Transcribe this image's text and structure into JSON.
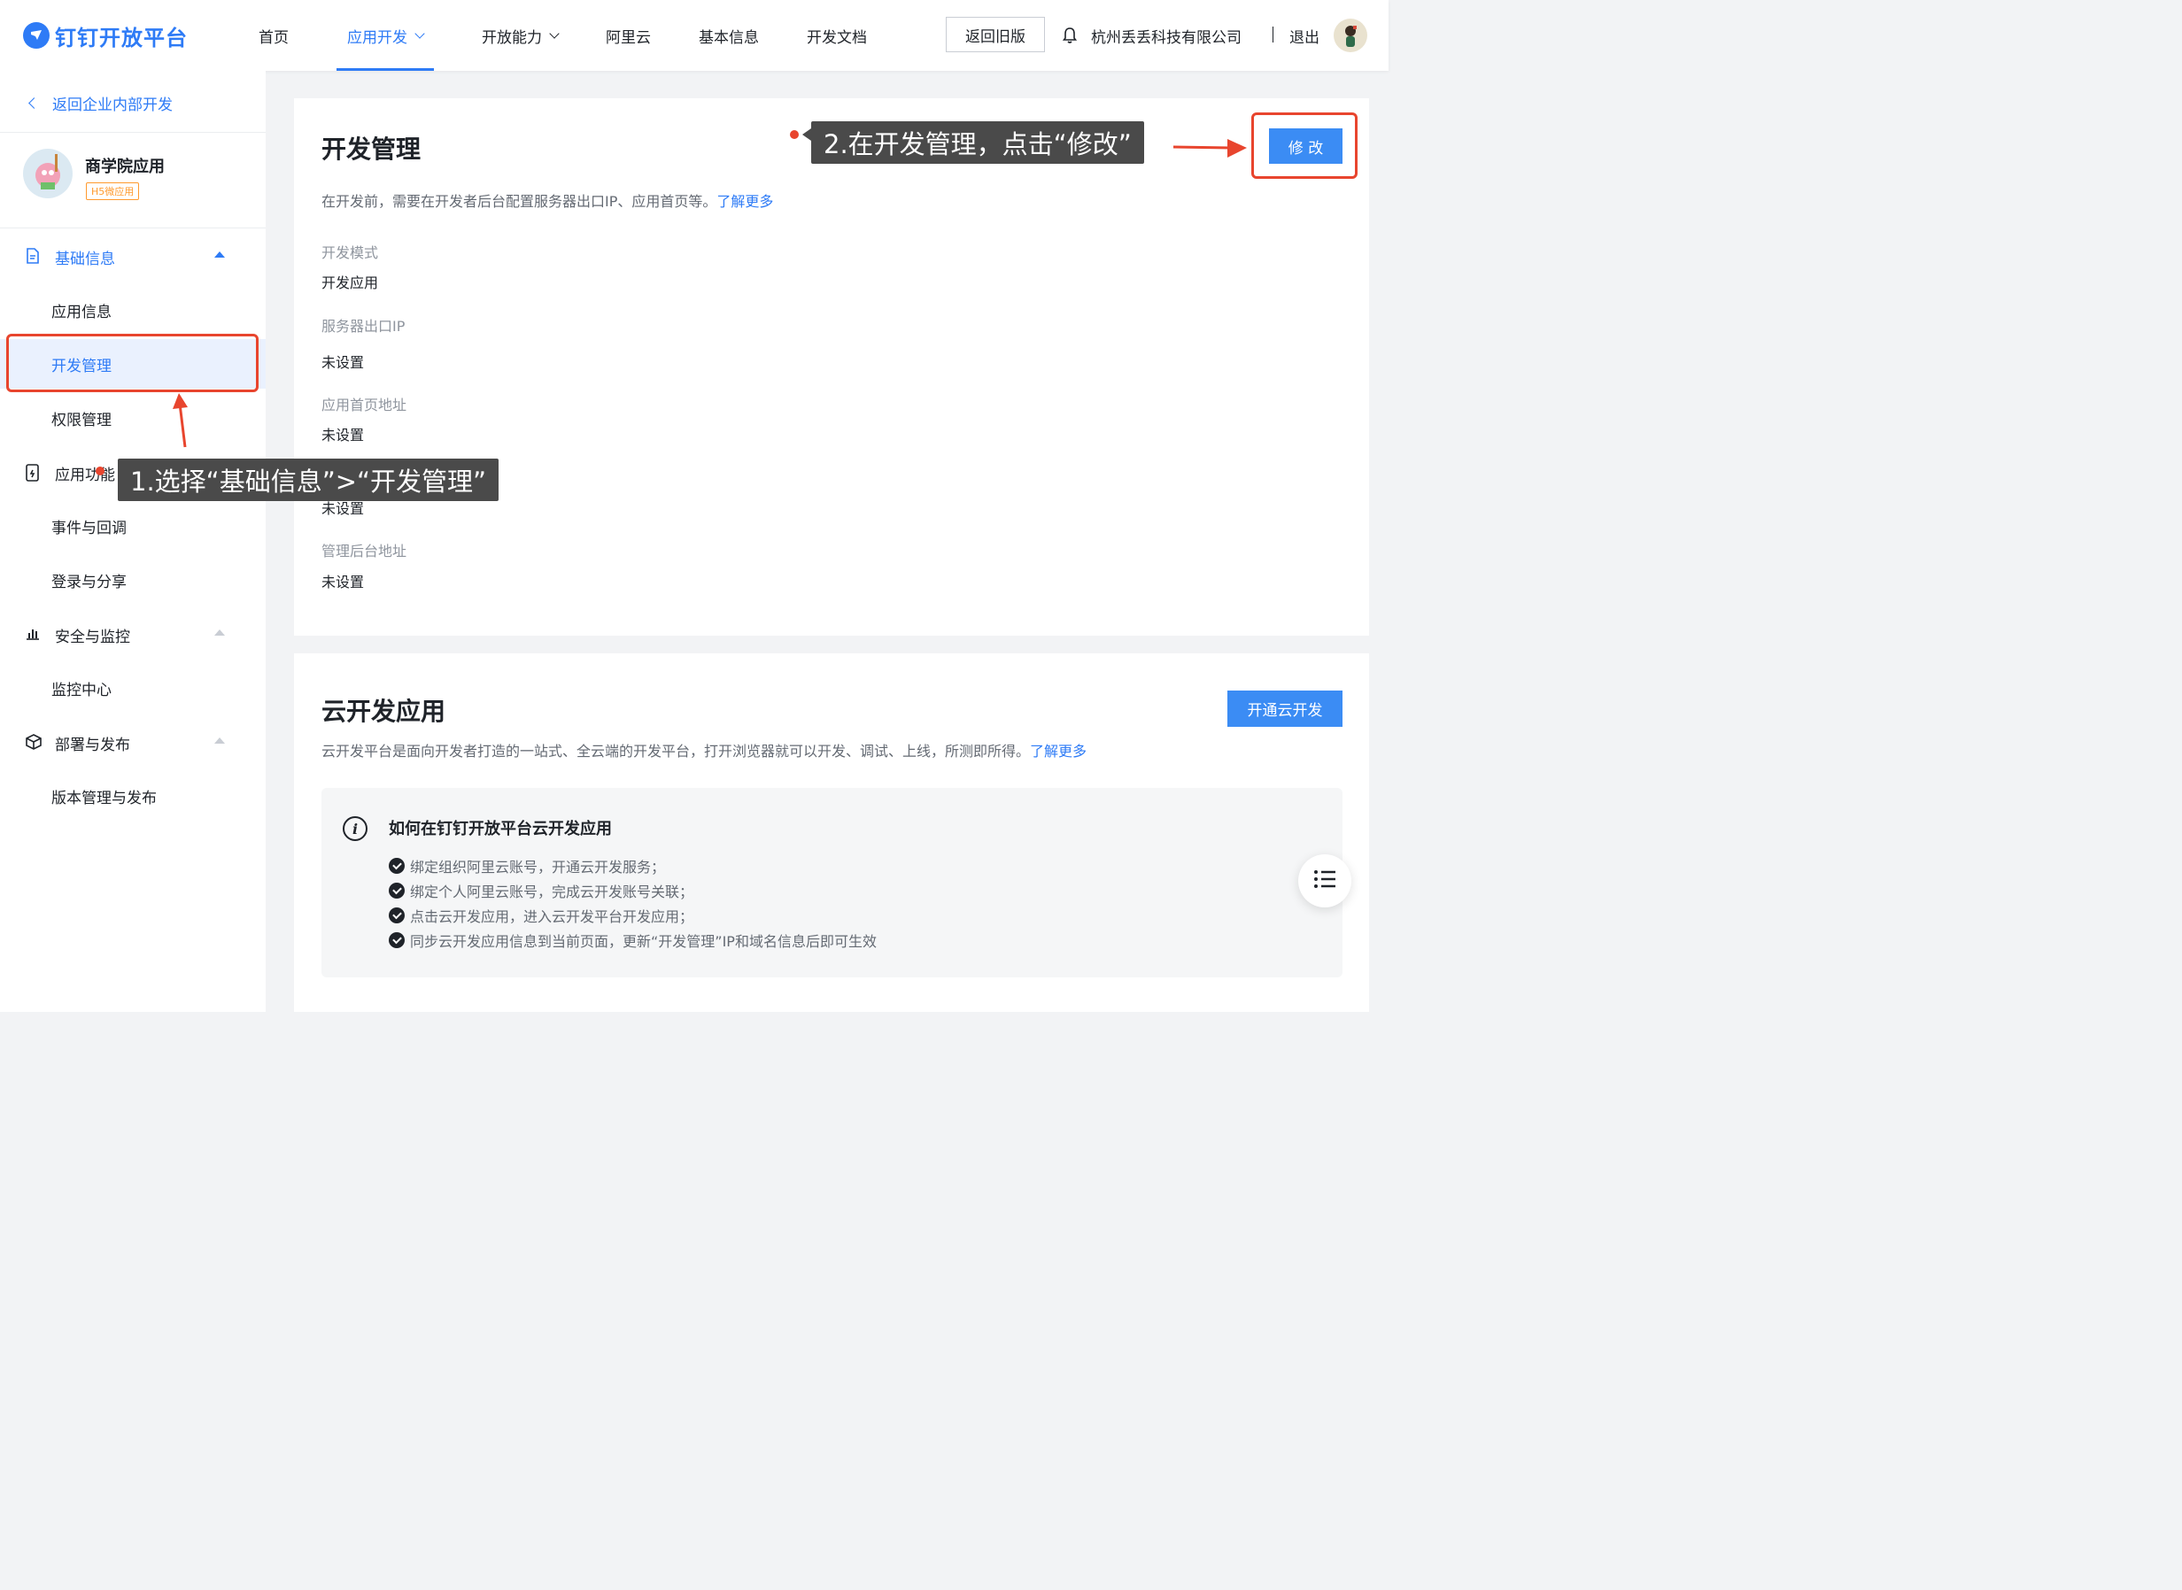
{
  "header": {
    "logo_text": "钉钉开放平台",
    "nav": [
      {
        "label": "首页"
      },
      {
        "label": "应用开发"
      },
      {
        "label": "开放能力"
      },
      {
        "label": "阿里云"
      },
      {
        "label": "基本信息"
      },
      {
        "label": "开发文档"
      }
    ],
    "old_version_label": "返回旧版",
    "company": "杭州丢丢科技有限公司",
    "logout": "退出"
  },
  "sidebar": {
    "back_label": "返回企业内部开发",
    "app_name": "商学院应用",
    "app_tag": "H5微应用",
    "groups": {
      "basic": "基础信息",
      "features": "应用功能",
      "security": "安全与监控",
      "deploy": "部署与发布"
    },
    "items": {
      "app_info": "应用信息",
      "dev_manage": "开发管理",
      "permission": "权限管理",
      "events": "事件与回调",
      "login_share": "登录与分享",
      "monitor": "监控中心",
      "version": "版本管理与发布"
    }
  },
  "dev_card": {
    "title": "开发管理",
    "desc": "在开发前，需要在开发者后台配置服务器出口IP、应用首页等。",
    "learn_more": "了解更多",
    "edit_label": "修 改",
    "fields": [
      {
        "label": "开发模式",
        "value": "开发应用"
      },
      {
        "label": "服务器出口IP",
        "value": "未设置"
      },
      {
        "label": "应用首页地址",
        "value": "未设置"
      },
      {
        "label": "",
        "value": "未设置"
      },
      {
        "label": "管理后台地址",
        "value": "未设置"
      }
    ]
  },
  "cloud_card": {
    "title": "云开发应用",
    "desc": "云开发平台是面向开发者打造的一站式、全云端的开发平台，打开浏览器就可以开发、调试、上线，所测即所得。",
    "learn_more": "了解更多",
    "button_label": "开通云开发",
    "info_title": "如何在钉钉开放平台云开发应用",
    "steps": [
      "绑定组织阿里云账号，开通云开发服务；",
      "绑定个人阿里云账号，完成云开发账号关联；",
      "点击云开发应用，进入云开发平台开发应用；",
      "同步云开发应用信息到当前页面，更新“开发管理”IP和域名信息后即可生效"
    ]
  },
  "annotations": {
    "step1": "1.选择“基础信息”>“开发管理”",
    "step2": "2.在开发管理，点击“修改”"
  },
  "colors": {
    "brand": "#2e7bf6",
    "annotation_red": "#e8452e",
    "callout_bg": "#4a4a4a",
    "tag_orange": "#ff9a2e"
  },
  "icons": {
    "logo": "dingtalk-logo-icon",
    "bell": "bell-icon",
    "document": "document-icon",
    "phone": "phone-icon",
    "chart": "bar-chart-icon",
    "cube": "cube-icon",
    "info": "info-icon",
    "checklist": "checklist-icon"
  }
}
